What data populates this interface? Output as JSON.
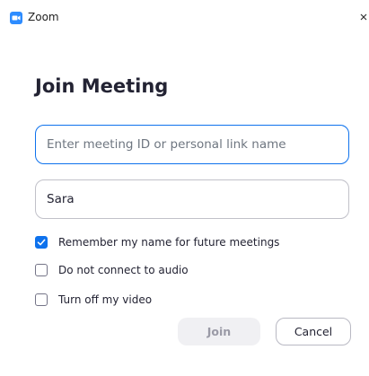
{
  "window": {
    "app_title": "Zoom",
    "app_icon": "zoom-logo-icon",
    "close_icon": "close-icon"
  },
  "form": {
    "heading": "Join Meeting",
    "meeting_id": {
      "value": "",
      "placeholder": "Enter meeting ID or personal link name"
    },
    "name": {
      "value": "Sara",
      "placeholder": ""
    },
    "options": [
      {
        "label": "Remember my name for future meetings",
        "checked": true
      },
      {
        "label": "Do not connect to audio",
        "checked": false
      },
      {
        "label": "Turn off my video",
        "checked": false
      }
    ]
  },
  "buttons": {
    "join_label": "Join",
    "cancel_label": "Cancel"
  },
  "colors": {
    "accent": "#0e72ed",
    "text": "#232333",
    "disabled_bg": "#f0f0f3",
    "disabled_text": "#9a9aa6"
  }
}
